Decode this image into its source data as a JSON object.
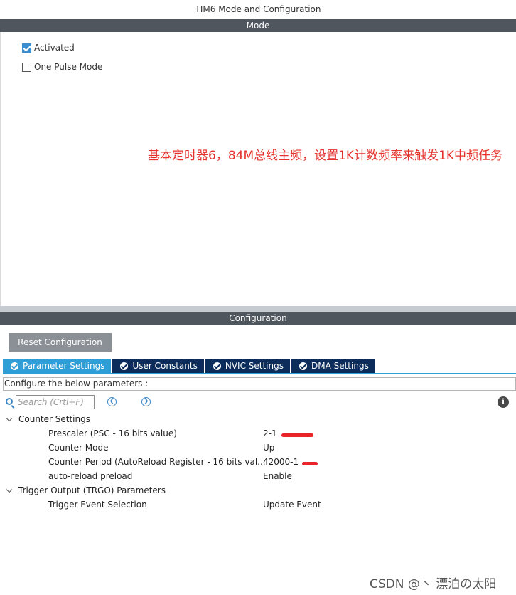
{
  "window": {
    "title": "TIM6 Mode and Configuration"
  },
  "mode": {
    "header": "Mode",
    "options": [
      {
        "label": "Activated",
        "checked": true
      },
      {
        "label": "One Pulse Mode",
        "checked": false
      }
    ]
  },
  "annotation": {
    "text": "基本定时器6，84M总线主频，设置1K计数频率来触发1K中频任务"
  },
  "configuration": {
    "header": "Configuration",
    "reset_label": "Reset Configuration",
    "tabs": [
      {
        "label": "Parameter Settings",
        "active": true
      },
      {
        "label": "User Constants",
        "active": false
      },
      {
        "label": "NVIC Settings",
        "active": false
      },
      {
        "label": "DMA Settings",
        "active": false
      }
    ],
    "hint": "Configure the below parameters :",
    "search": {
      "placeholder": "Search (Crtl+F)"
    },
    "icons": {
      "search": "search-icon",
      "prev": "chevron-left-circle-icon",
      "next": "chevron-right-circle-icon",
      "info": "info-icon"
    },
    "groups": [
      {
        "name": "Counter Settings",
        "params": [
          {
            "name": "Prescaler (PSC - 16 bits value)",
            "value": "2-1"
          },
          {
            "name": "Counter Mode",
            "value": "Up"
          },
          {
            "name": "Counter Period (AutoReload Register - 16 bits val...",
            "value": "42000-1"
          },
          {
            "name": "auto-reload preload",
            "value": "Enable"
          }
        ]
      },
      {
        "name": "Trigger Output (TRGO) Parameters",
        "params": [
          {
            "name": "Trigger Event Selection",
            "value": "Update Event"
          }
        ]
      }
    ]
  },
  "watermark": "CSDN @丶 漂泊の太阳",
  "colors": {
    "header_bg": "#4f565e",
    "tab_active": "#2f9dd6",
    "tab_inactive": "#0c2d5b",
    "annotation": "#e5322d",
    "highlight_mark": "#e8232a",
    "checkbox_checked": "#3d8ecf"
  }
}
